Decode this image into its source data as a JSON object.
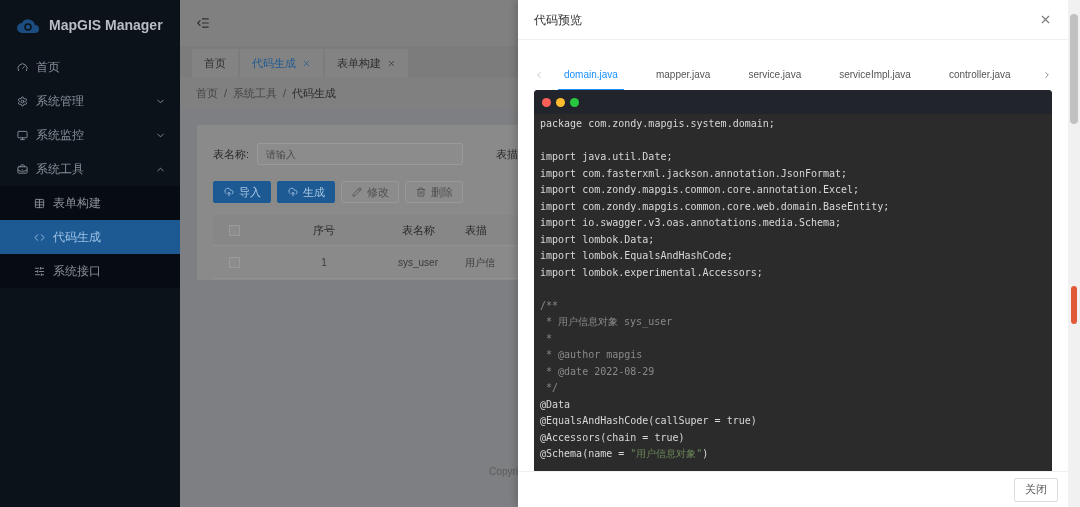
{
  "sidebar": {
    "logo": "MapGIS Manager",
    "items": [
      {
        "label": "首页",
        "selected": false
      },
      {
        "label": "系统管理",
        "expanded": false,
        "selected": false
      },
      {
        "label": "系统监控",
        "expanded": false,
        "selected": false
      },
      {
        "label": "系统工具",
        "expanded": true,
        "selected": false,
        "children": [
          {
            "label": "表单构建",
            "selected": false
          },
          {
            "label": "代码生成",
            "selected": true
          },
          {
            "label": "系统接口",
            "selected": false
          }
        ]
      }
    ]
  },
  "page_tabs": [
    {
      "label": "首页",
      "selected": false,
      "closable": false
    },
    {
      "label": "代码生成",
      "selected": true,
      "closable": true
    },
    {
      "label": "表单构建",
      "selected": false,
      "closable": true
    }
  ],
  "breadcrumb": {
    "items": [
      "首页",
      "系统工具",
      "代码生成"
    ],
    "separator": "/"
  },
  "filters": [
    {
      "label": "表名称:",
      "placeholder": "请输入"
    },
    {
      "label": "表描"
    }
  ],
  "buttons": [
    {
      "label": "导入",
      "disabled": false,
      "primary": true
    },
    {
      "label": "生成",
      "disabled": false,
      "primary": true
    },
    {
      "label": "修改",
      "disabled": true,
      "primary": false
    },
    {
      "label": "删除",
      "disabled": true,
      "primary": false
    }
  ],
  "table": {
    "select_all_checked": false,
    "columns": [
      "序号",
      "表名称",
      "表描"
    ],
    "rows": [
      {
        "checked": false,
        "cells": [
          "1",
          "sys_user",
          "用户信"
        ]
      }
    ]
  },
  "footer": "Copyri",
  "drawer": {
    "title": "代码预览",
    "tabs": [
      {
        "label": "domain.java",
        "selected": true
      },
      {
        "label": "mapper.java",
        "selected": false
      },
      {
        "label": "service.java",
        "selected": false
      },
      {
        "label": "serviceImpl.java",
        "selected": false
      },
      {
        "label": "controller.java",
        "selected": false
      }
    ],
    "code": [
      {
        "parts": [
          {
            "text": "package com.zondy.mapgis.system.domain;",
            "kind": "code"
          }
        ]
      },
      {
        "kind": "blank"
      },
      {
        "parts": [
          {
            "text": "import java.util.Date;",
            "kind": "code"
          }
        ]
      },
      {
        "parts": [
          {
            "text": "import com.fasterxml.jackson.annotation.JsonFormat;",
            "kind": "code"
          }
        ]
      },
      {
        "parts": [
          {
            "text": "import com.zondy.mapgis.common.core.annotation.Excel;",
            "kind": "code"
          }
        ]
      },
      {
        "parts": [
          {
            "text": "import com.zondy.mapgis.common.core.web.domain.BaseEntity;",
            "kind": "code"
          }
        ]
      },
      {
        "parts": [
          {
            "text": "import io.swagger.v3.oas.annotations.media.Schema;",
            "kind": "code"
          }
        ]
      },
      {
        "parts": [
          {
            "text": "import lombok.Data;",
            "kind": "code"
          }
        ]
      },
      {
        "parts": [
          {
            "text": "import lombok.EqualsAndHashCode;",
            "kind": "code"
          }
        ]
      },
      {
        "parts": [
          {
            "text": "import lombok.experimental.Accessors;",
            "kind": "code"
          }
        ]
      },
      {
        "kind": "blank"
      },
      {
        "parts": [
          {
            "text": "/**",
            "kind": "comment"
          }
        ]
      },
      {
        "parts": [
          {
            "text": " * 用户信息对象 sys_user",
            "kind": "comment"
          }
        ]
      },
      {
        "parts": [
          {
            "text": " *",
            "kind": "comment"
          }
        ]
      },
      {
        "parts": [
          {
            "text": " * @author mapgis",
            "kind": "comment"
          }
        ]
      },
      {
        "parts": [
          {
            "text": " * @date 2022-08-29",
            "kind": "comment"
          }
        ]
      },
      {
        "parts": [
          {
            "text": " */",
            "kind": "comment"
          }
        ]
      },
      {
        "parts": [
          {
            "text": "@Data",
            "kind": "code"
          }
        ]
      },
      {
        "parts": [
          {
            "text": "@EqualsAndHashCode(callSuper = true)",
            "kind": "code"
          }
        ]
      },
      {
        "parts": [
          {
            "text": "@Accessors(chain = true)",
            "kind": "code"
          }
        ]
      },
      {
        "parts": [
          {
            "text": "@Schema(name = ",
            "kind": "code"
          },
          {
            "text": "\"用户信息对象\"",
            "kind": "string"
          },
          {
            "text": ")",
            "kind": "code"
          }
        ]
      }
    ],
    "close_button": "关闭"
  }
}
